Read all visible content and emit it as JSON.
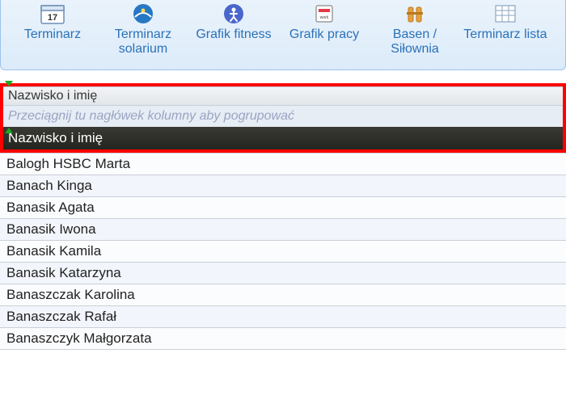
{
  "toolbar": {
    "items": [
      {
        "label": "Terminarz"
      },
      {
        "label": "Terminarz solarium"
      },
      {
        "label": "Grafik fitness"
      },
      {
        "label": "Grafik pracy"
      },
      {
        "label": "Basen / Siłownia"
      },
      {
        "label": "Terminarz lista"
      }
    ]
  },
  "grid_area": {
    "column_header": "Nazwisko i imię",
    "group_hint": "Przeciągnij tu nagłówek kolumny aby pogrupować",
    "active_header": "Nazwisko i imię"
  },
  "rows": [
    "Balogh HSBC Marta",
    "Banach Kinga",
    "Banasik Agata",
    "Banasik Iwona",
    "Banasik Kamila",
    "Banasik Katarzyna",
    "Banaszczak Karolina",
    "Banaszczak Rafał",
    "Banaszczyk Małgorzata"
  ]
}
